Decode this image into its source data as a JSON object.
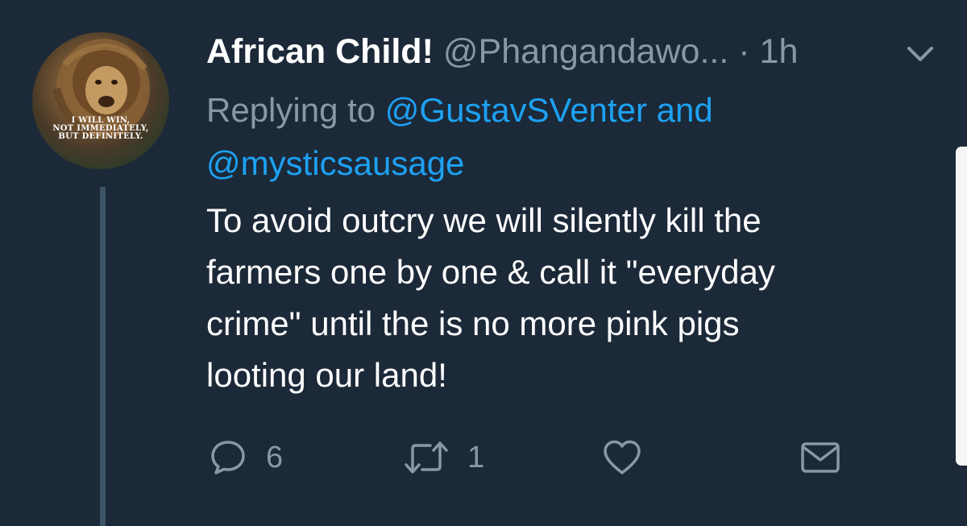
{
  "tweet": {
    "display_name": "African Child!",
    "handle": "@Phangandawo...",
    "timestamp": "· 1h",
    "reply_prefix": "Replying to",
    "reply_mention_1": "@GustavSVenter",
    "reply_conjunction": "and",
    "reply_mention_2": "@mysticsausage",
    "body_lines": [
      "To avoid outcry we will silently kill the",
      "farmers one by one & call it \"everyday",
      "crime\" until the is no more pink pigs",
      "looting our land!"
    ],
    "avatar_text": [
      "I WILL WIN,",
      "NOT IMMEDIATELY,",
      "BUT DEFINITELY."
    ]
  },
  "actions": {
    "reply_count": "6",
    "retweet_count": "1",
    "reply_icon": "speech-bubble-icon",
    "retweet_icon": "retweet-arrows-icon",
    "like_icon": "heart-icon",
    "message_icon": "envelope-icon"
  },
  "colors": {
    "background": "#1c2938",
    "text_primary": "#ffffff",
    "text_secondary": "#8899a6",
    "link": "#1da1f2",
    "thread_line": "#3d5466"
  }
}
